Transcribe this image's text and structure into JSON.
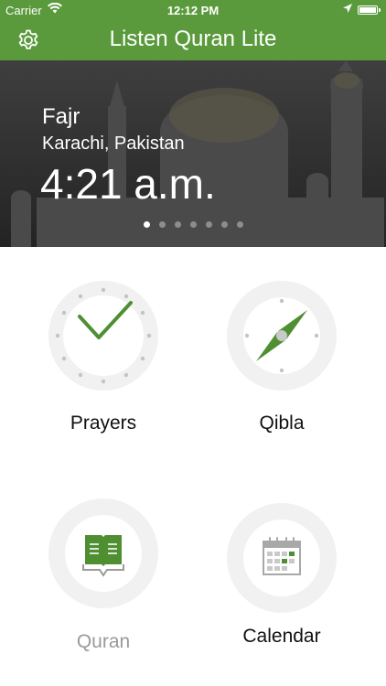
{
  "status_bar": {
    "carrier": "Carrier",
    "time": "12:12 PM"
  },
  "nav": {
    "title": "Listen Quran Lite",
    "settings_icon": "gear-icon"
  },
  "hero": {
    "prayer_name": "Fajr",
    "location": "Karachi, Pakistan",
    "prayer_time": "4:21 a.m.",
    "page_count": 7,
    "active_page": 1
  },
  "menu": {
    "prayers": {
      "label": "Prayers",
      "icon": "clock-check-icon"
    },
    "qibla": {
      "label": "Qibla",
      "icon": "compass-icon"
    },
    "quran": {
      "label": "Quran",
      "icon": "book-icon"
    },
    "calendar": {
      "label": "Calendar",
      "icon": "calendar-icon"
    }
  },
  "colors": {
    "brand_green": "#5a9a3c",
    "icon_green": "#4f8f32",
    "circle_grey": "#f1f1f1",
    "dim_text": "#9a9a9a"
  }
}
